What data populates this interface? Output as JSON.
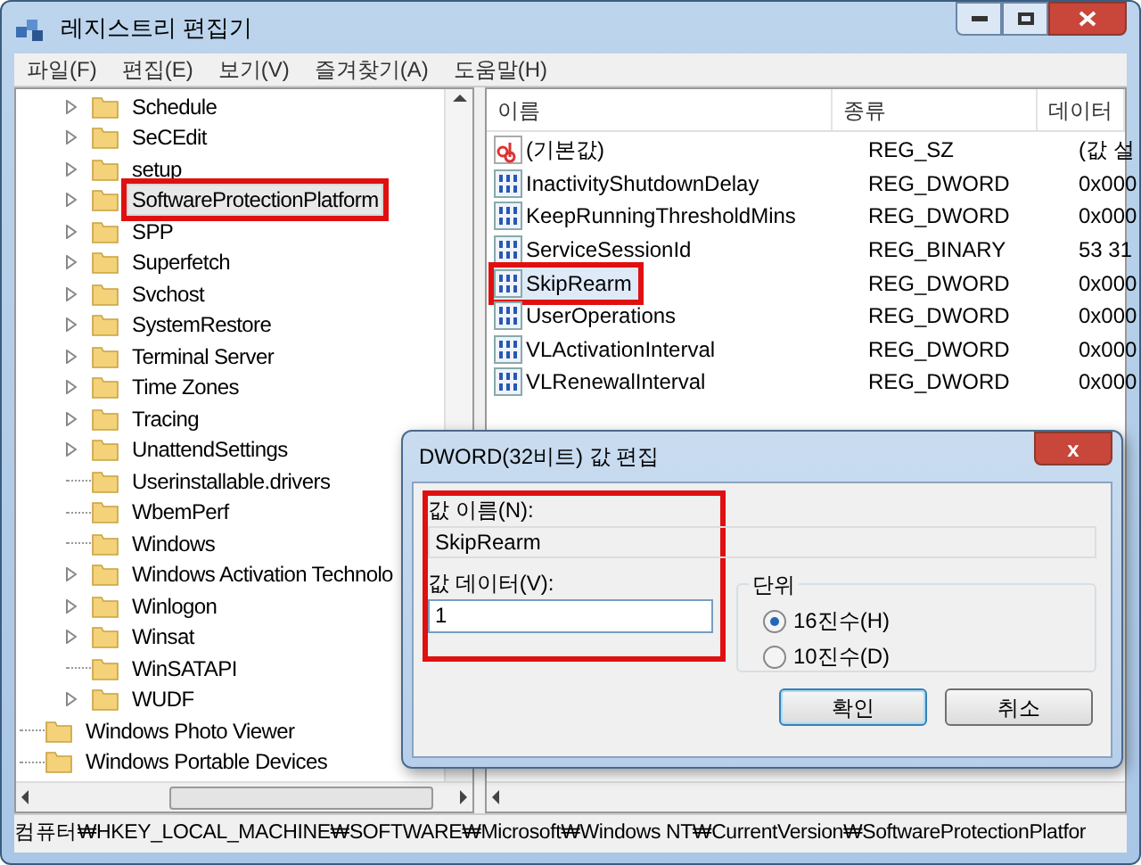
{
  "window": {
    "title": "레지스트리 편집기"
  },
  "menu": [
    "파일(F)",
    "편집(E)",
    "보기(V)",
    "즐겨찾기(A)",
    "도움말(H)"
  ],
  "tree": {
    "items": [
      {
        "children": [
          {
            "label": "Schedule",
            "expandable": true,
            "selected": false,
            "annotated": false
          },
          {
            "label": "SeCEdit",
            "expandable": true,
            "selected": false,
            "annotated": false
          },
          {
            "label": "setup",
            "expandable": true,
            "selected": false,
            "annotated": false
          },
          {
            "label": "SoftwareProtectionPlatform",
            "expandable": true,
            "selected": true,
            "annotated": true
          },
          {
            "label": "SPP",
            "expandable": true,
            "selected": false,
            "annotated": false
          },
          {
            "label": "Superfetch",
            "expandable": true,
            "selected": false,
            "annotated": false
          },
          {
            "label": "Svchost",
            "expandable": true,
            "selected": false,
            "annotated": false
          },
          {
            "label": "SystemRestore",
            "expandable": true,
            "selected": false,
            "annotated": false
          },
          {
            "label": "Terminal Server",
            "expandable": true,
            "selected": false,
            "annotated": false
          },
          {
            "label": "Time Zones",
            "expandable": true,
            "selected": false,
            "annotated": false
          },
          {
            "label": "Tracing",
            "expandable": true,
            "selected": false,
            "annotated": false
          },
          {
            "label": "UnattendSettings",
            "expandable": true,
            "selected": false,
            "annotated": false
          },
          {
            "label": "Userinstallable.drivers",
            "expandable": false,
            "selected": false,
            "annotated": false
          },
          {
            "label": "WbemPerf",
            "expandable": false,
            "selected": false,
            "annotated": false
          },
          {
            "label": "Windows",
            "expandable": false,
            "selected": false,
            "annotated": false
          },
          {
            "label": "Windows Activation Technolo",
            "expandable": true,
            "selected": false,
            "annotated": false
          },
          {
            "label": "Winlogon",
            "expandable": true,
            "selected": false,
            "annotated": false
          },
          {
            "label": "Winsat",
            "expandable": true,
            "selected": false,
            "annotated": false
          },
          {
            "label": "WinSATAPI",
            "expandable": false,
            "selected": false,
            "annotated": false
          },
          {
            "label": "WUDF",
            "expandable": true,
            "selected": false,
            "annotated": false
          }
        ]
      },
      {
        "label": "Windows Photo Viewer",
        "expandable": false,
        "selected": false,
        "annotated": false
      },
      {
        "label": "Windows Portable Devices",
        "expandable": false,
        "selected": false,
        "annotated": false
      }
    ]
  },
  "values": {
    "columns": [
      "이름",
      "종류",
      "데이터"
    ],
    "rows": [
      {
        "kind": "string",
        "name": "(기본값)",
        "type": "REG_SZ",
        "data": "(값 설",
        "selected": false,
        "annotated": false
      },
      {
        "kind": "binary",
        "name": "InactivityShutdownDelay",
        "type": "REG_DWORD",
        "data": "0x000",
        "selected": false,
        "annotated": false
      },
      {
        "kind": "binary",
        "name": "KeepRunningThresholdMins",
        "type": "REG_DWORD",
        "data": "0x000",
        "selected": false,
        "annotated": false
      },
      {
        "kind": "binary",
        "name": "ServiceSessionId",
        "type": "REG_BINARY",
        "data": "53 31",
        "selected": false,
        "annotated": false
      },
      {
        "kind": "binary",
        "name": "SkipRearm",
        "type": "REG_DWORD",
        "data": "0x000",
        "selected": true,
        "annotated": true
      },
      {
        "kind": "binary",
        "name": "UserOperations",
        "type": "REG_DWORD",
        "data": "0x000",
        "selected": false,
        "annotated": false
      },
      {
        "kind": "binary",
        "name": "VLActivationInterval",
        "type": "REG_DWORD",
        "data": "0x000",
        "selected": false,
        "annotated": false
      },
      {
        "kind": "binary",
        "name": "VLRenewalInterval",
        "type": "REG_DWORD",
        "data": "0x000",
        "selected": false,
        "annotated": false
      }
    ]
  },
  "dialog": {
    "title": "DWORD(32비트) 값 편집",
    "close": "x",
    "annotated": true,
    "name_label": "값 이름(N):",
    "name_value": "SkipRearm",
    "data_label": "값 데이터(V):",
    "data_value": "1",
    "base": {
      "label": "단위",
      "options": [
        {
          "label": "16진수(H)",
          "selected": true
        },
        {
          "label": "10진수(D)",
          "selected": false
        }
      ]
    },
    "buttons": [
      {
        "label": "확인",
        "default": true
      },
      {
        "label": "취소",
        "default": false
      }
    ]
  },
  "status_bar": "컴퓨터₩HKEY_LOCAL_MACHINE₩SOFTWARE₩Microsoft₩Windows NT₩CurrentVersion₩SoftwareProtectionPlatfor"
}
